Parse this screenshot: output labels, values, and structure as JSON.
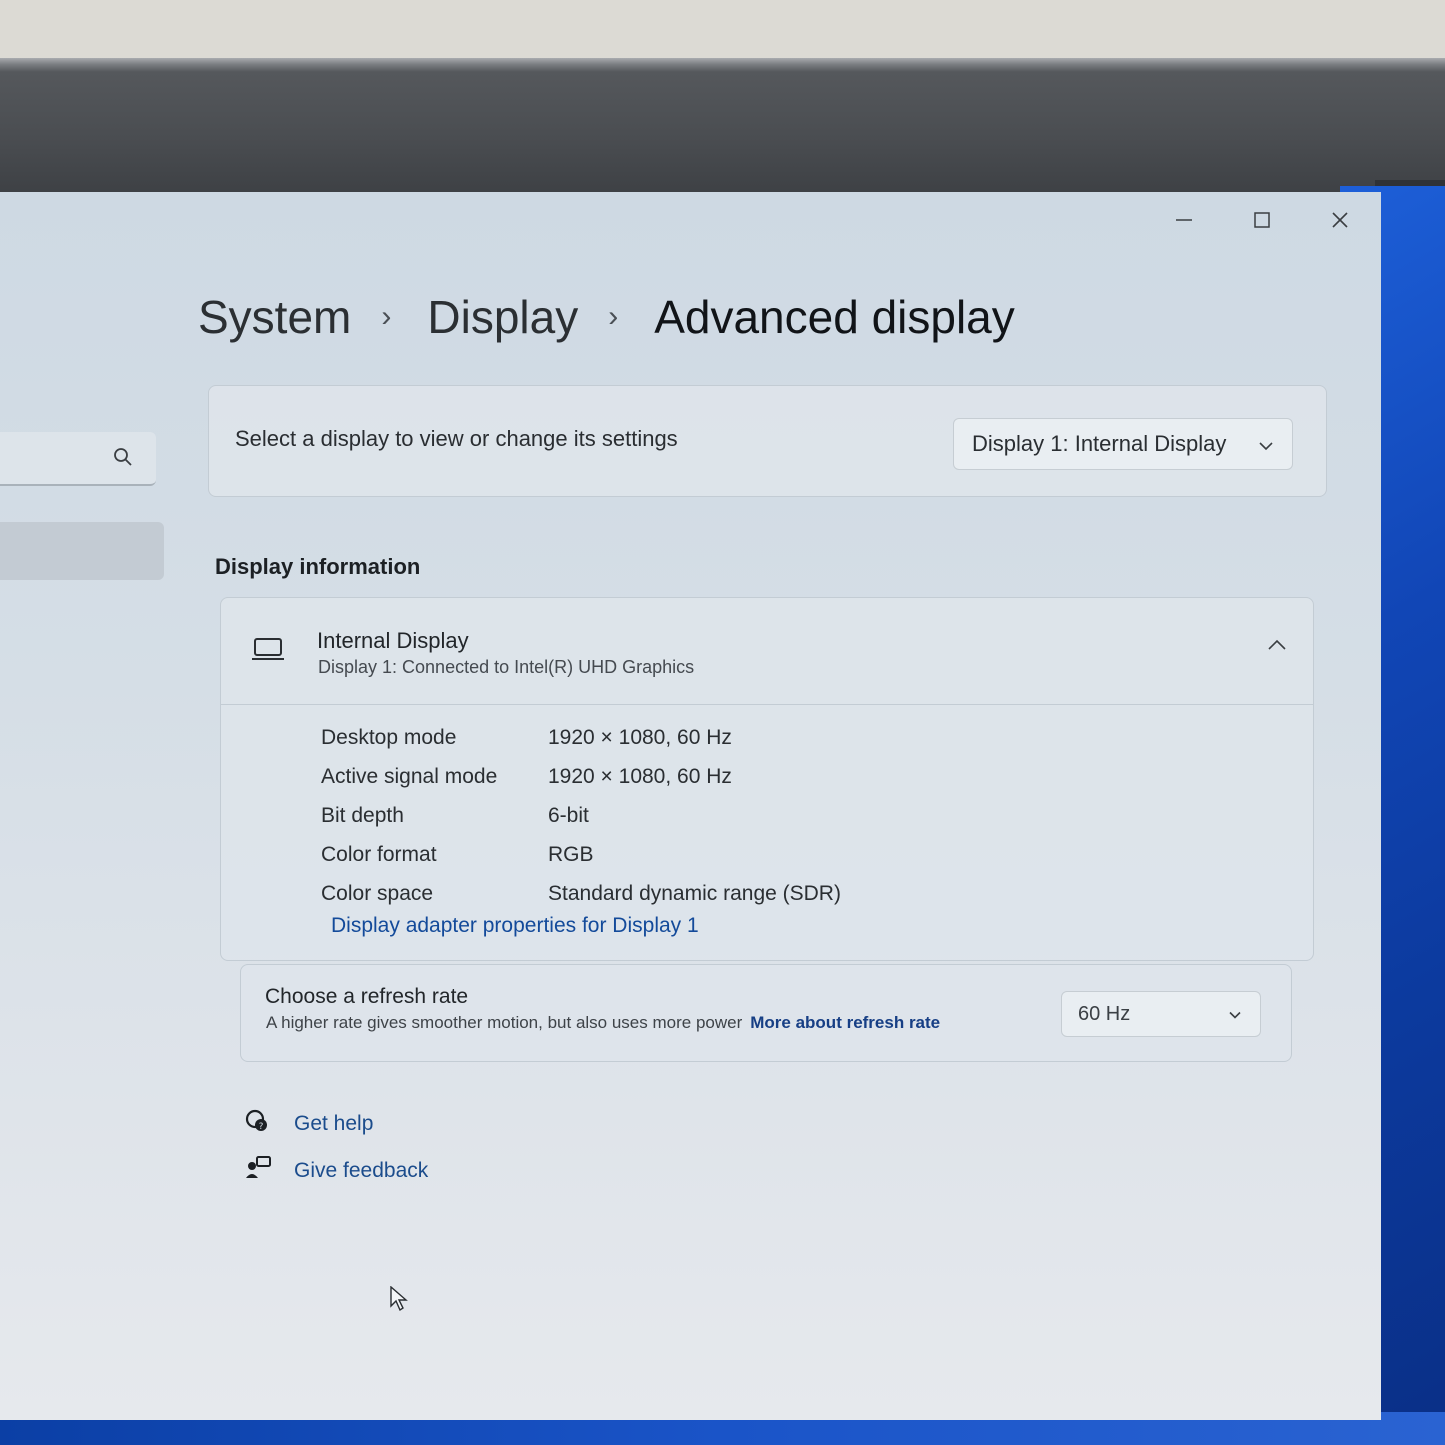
{
  "window": {
    "controls": {
      "minimize": "minimize-icon",
      "maximize": "maximize-icon",
      "close": "close-icon"
    }
  },
  "sidebar": {
    "search_icon": "search-icon"
  },
  "breadcrumb": {
    "level1": "System",
    "level2": "Display",
    "current": "Advanced display",
    "separator": "›"
  },
  "select_display": {
    "label": "Select a display to view or change its settings",
    "dropdown_value": "Display 1: Internal Display"
  },
  "display_information": {
    "section_title": "Display information",
    "display_name": "Internal Display",
    "display_subtitle": "Display 1: Connected to Intel(R) UHD Graphics",
    "properties": [
      {
        "key": "Desktop mode",
        "value": "1920 × 1080, 60 Hz"
      },
      {
        "key": "Active signal mode",
        "value": "1920 × 1080, 60 Hz"
      },
      {
        "key": "Bit depth",
        "value": "6-bit"
      },
      {
        "key": "Color format",
        "value": "RGB"
      },
      {
        "key": "Color space",
        "value": "Standard dynamic range (SDR)"
      }
    ],
    "adapter_link": "Display adapter properties for Display 1"
  },
  "refresh_rate": {
    "title": "Choose a refresh rate",
    "description": "A higher rate gives smoother motion, but also uses more power",
    "more_link": "More about refresh rate",
    "selected": "60 Hz"
  },
  "help": {
    "get_help": "Get help",
    "give_feedback": "Give feedback"
  },
  "colors": {
    "accent_link": "#134a9a",
    "window_bg": "#d5dee6",
    "wallpaper": "#1146b6"
  }
}
